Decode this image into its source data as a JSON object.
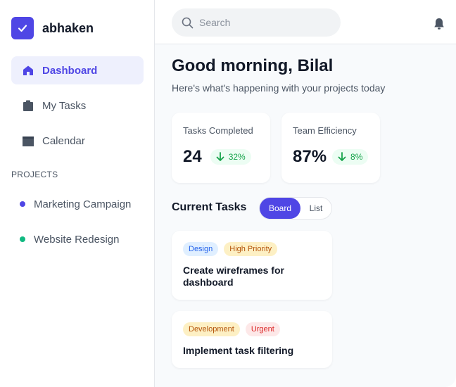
{
  "brand": {
    "name": "abhaken",
    "accent": "#4f46e5"
  },
  "nav": [
    {
      "label": "Dashboard",
      "icon": "home-icon",
      "active": true
    },
    {
      "label": "My Tasks",
      "icon": "clipboard-icon",
      "active": false
    },
    {
      "label": "Calendar",
      "icon": "calendar-icon",
      "active": false
    }
  ],
  "projects": {
    "heading": "PROJECTS",
    "items": [
      {
        "label": "Marketing Campaign",
        "color": "#4f46e5"
      },
      {
        "label": "Website Redesign",
        "color": "#10b981"
      }
    ]
  },
  "search": {
    "placeholder": "Search",
    "value": "",
    "icon": "search-icon"
  },
  "header": {
    "notification_icon": "bell-icon"
  },
  "greeting": {
    "title": "Good morning, Bilal",
    "subtitle": "Here's what's happening with your projects today"
  },
  "stats": [
    {
      "label": "Tasks Completed",
      "value": "24",
      "change": "32%",
      "trend_icon": "arrow-down-icon"
    },
    {
      "label": "Team Efficiency",
      "value": "87%",
      "change": "8%",
      "trend_icon": "arrow-down-icon"
    }
  ],
  "tasks": {
    "heading": "Current Tasks",
    "views": {
      "board": "Board",
      "list": "List",
      "selected": "Board"
    },
    "items": [
      {
        "tags": [
          {
            "label": "Design",
            "bg": "#e0efff",
            "fg": "#2563eb"
          },
          {
            "label": "High Priority",
            "bg": "#fdf0c4",
            "fg": "#b45309"
          }
        ],
        "title": "Create wireframes for dashboard"
      },
      {
        "tags": [
          {
            "label": "Development",
            "bg": "#fdf0c4",
            "fg": "#b45309"
          },
          {
            "label": "Urgent",
            "bg": "#fde8e8",
            "fg": "#dc2626"
          }
        ],
        "title": "Implement task filtering"
      }
    ]
  }
}
